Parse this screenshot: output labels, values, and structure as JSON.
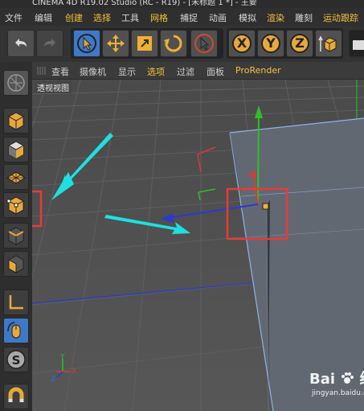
{
  "title_bar": {
    "text": "CINEMA 4D R19.02 Studio (RC - R19) - [未标题 1 *] - 主要"
  },
  "menu": {
    "items": [
      "文件",
      "编辑",
      "创建",
      "选择",
      "工具",
      "网格",
      "捕捉",
      "动画",
      "模拟",
      "渲染",
      "雕刻",
      "运动跟踪"
    ],
    "highlight_items": [
      "创建",
      "选择",
      "网格",
      "渲染",
      "运动跟踪"
    ],
    "highlight_color": "#f0c23a"
  },
  "toolbar": {
    "x_label": "X",
    "y_label": "Y",
    "z_label": "Z"
  },
  "viewport_menu": {
    "items": [
      "查看",
      "摄像机",
      "显示",
      "选项",
      "过滤",
      "面板",
      "ProRender"
    ],
    "highlight_items": [
      "选项",
      "ProRender"
    ],
    "highlight_color": "#f0c23a"
  },
  "viewport": {
    "label": "透视视图",
    "axis_y_label": "Y",
    "axis_x_label": "X",
    "axis_z_label": "Z"
  },
  "annotations": {
    "arrow_color": "#1ee0e0",
    "box_color": "#e83a3a"
  },
  "watermark": {
    "logo_text": "Bai",
    "brand_text": "经验",
    "url": "jingyan.baidu.com"
  }
}
